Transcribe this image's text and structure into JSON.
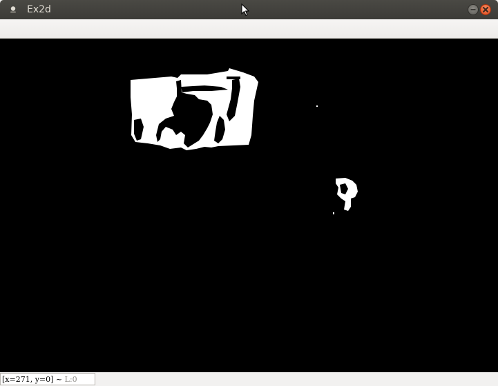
{
  "window": {
    "title": "Ex2d"
  },
  "statusbar": {
    "coords": "[x=271, y=0] ~ ",
    "level": "L:0"
  },
  "icons": {
    "app_menu": "app-menu-icon",
    "minimize": "minimize-icon",
    "close": "close-icon",
    "cursor": "mouse-cursor-icon"
  },
  "colors": {
    "titlebar": "#3c3b37",
    "close_button": "#e9541f",
    "canvas_background": "#000000",
    "blob": "#ffffff"
  }
}
